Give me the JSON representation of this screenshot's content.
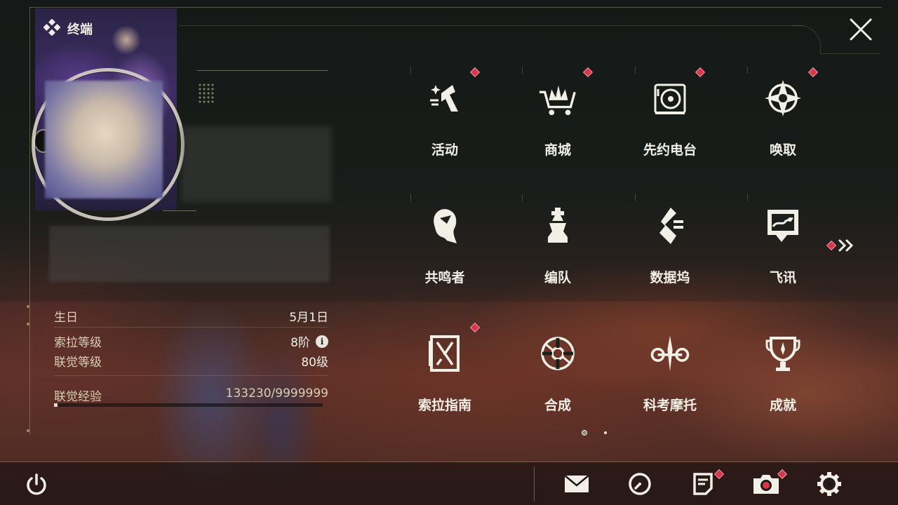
{
  "terminal": {
    "title": "终端"
  },
  "profile": {
    "birthday_label": "生日",
    "birthday_value": "5月1日",
    "sola_level_label": "索拉等级",
    "sola_level_value": "8阶",
    "union_level_label": "联觉等级",
    "union_level_value": "80级",
    "union_exp_label": "联觉经验",
    "union_exp_value": "133230/9999999",
    "union_exp_fraction": 0.0133
  },
  "menu": {
    "items": [
      {
        "label": "活动",
        "icon": "activity-icon",
        "badge": true
      },
      {
        "label": "商城",
        "icon": "shop-icon",
        "badge": true
      },
      {
        "label": "先约电台",
        "icon": "radio-icon",
        "badge": true
      },
      {
        "label": "唤取",
        "icon": "convene-icon",
        "badge": true
      },
      {
        "label": "共鸣者",
        "icon": "resonator-icon",
        "badge": false
      },
      {
        "label": "编队",
        "icon": "team-icon",
        "badge": false
      },
      {
        "label": "数据坞",
        "icon": "data-bank-icon",
        "badge": false
      },
      {
        "label": "飞讯",
        "icon": "message-icon",
        "badge": false
      },
      {
        "label": "索拉指南",
        "icon": "guidebook-icon",
        "badge": true
      },
      {
        "label": "合成",
        "icon": "synthesis-icon",
        "badge": false
      },
      {
        "label": "科考摩托",
        "icon": "motorcycle-icon",
        "badge": false
      },
      {
        "label": "成就",
        "icon": "trophy-icon",
        "badge": false
      }
    ],
    "page_current": 1,
    "page_total": 2
  },
  "colors": {
    "accent": "#e6dcc0",
    "badge": "#d8364a",
    "text": "#f2efe6",
    "label": "#d9cfb4"
  },
  "bottom_bar": [
    "power-icon",
    "mail-icon",
    "clock-icon",
    "notice-icon",
    "camera-icon",
    "settings-icon"
  ]
}
